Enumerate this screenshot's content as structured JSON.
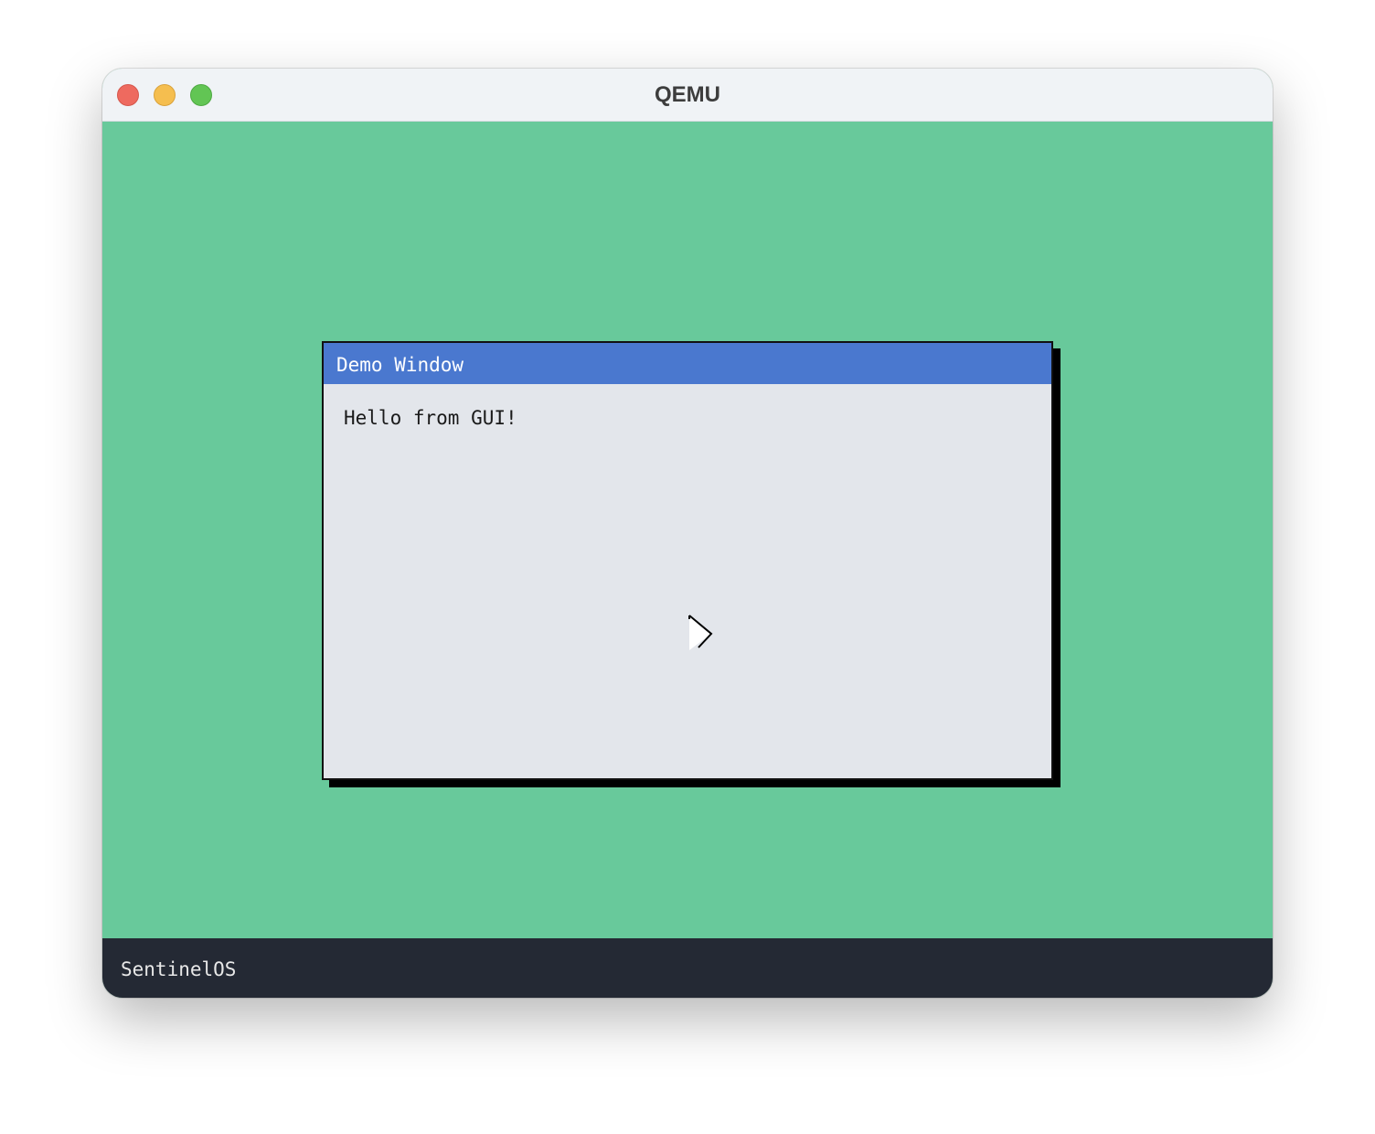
{
  "host_window": {
    "title": "QEMU",
    "controls": {
      "close_icon": "close-icon",
      "minimize_icon": "minimize-icon",
      "zoom_icon": "zoom-icon"
    }
  },
  "guest": {
    "desktop_color": "#68c99b",
    "demo_window": {
      "title": "Demo Window",
      "content_text": "Hello from GUI!",
      "title_bar_color": "#4a78cf",
      "body_color": "#e3e6eb"
    },
    "cursor_icon": "mouse-pointer-icon",
    "taskbar": {
      "label": "SentinelOS",
      "color": "#242934"
    }
  }
}
